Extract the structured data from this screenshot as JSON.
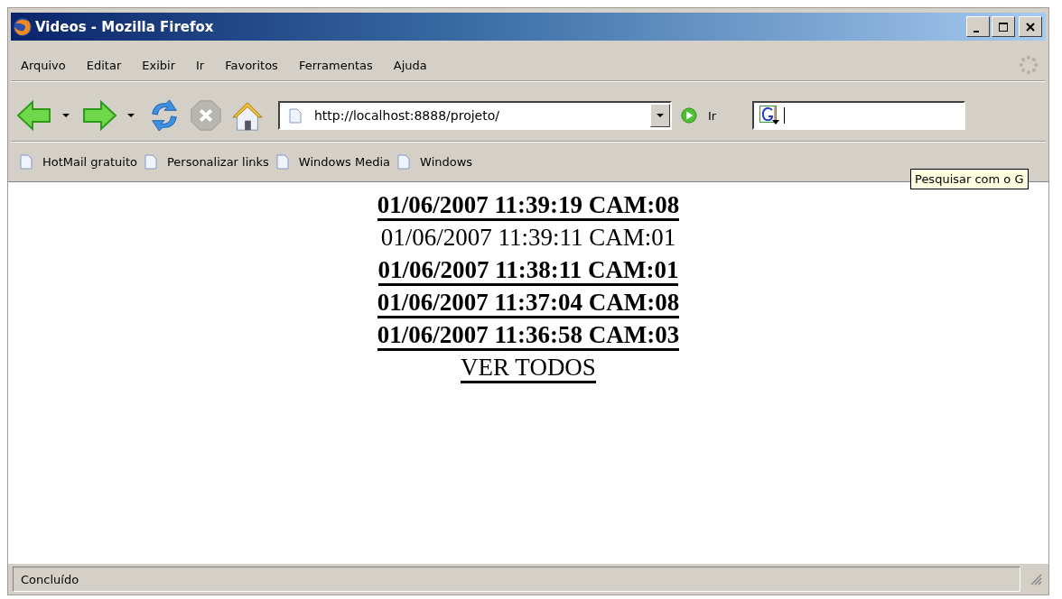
{
  "window": {
    "title": "Videos - Mozilla Firefox"
  },
  "menu": [
    {
      "label": "Arquivo"
    },
    {
      "label": "Editar"
    },
    {
      "label": "Exibir"
    },
    {
      "label": "Ir"
    },
    {
      "label": "Favoritos"
    },
    {
      "label": "Ferramentas"
    },
    {
      "label": "Ajuda"
    }
  ],
  "toolbar": {
    "address": "http://localhost:8888/projeto/",
    "go_label": "Ir"
  },
  "bookmarks": [
    "HotMail gratuito",
    "Personalizar links",
    "Windows Media",
    "Windows"
  ],
  "tooltip": "Pesquisar com o G",
  "entries": [
    {
      "text": "01/06/2007 11:39:19 CAM:08",
      "kind": "link"
    },
    {
      "text": "01/06/2007 11:39:11 CAM:01",
      "kind": "plain"
    },
    {
      "text": "01/06/2007 11:38:11 CAM:01",
      "kind": "link"
    },
    {
      "text": "01/06/2007 11:37:04 CAM:08",
      "kind": "link"
    },
    {
      "text": "01/06/2007 11:36:58 CAM:03",
      "kind": "link"
    }
  ],
  "see_all": "VER TODOS",
  "status_bar": "Concluído"
}
